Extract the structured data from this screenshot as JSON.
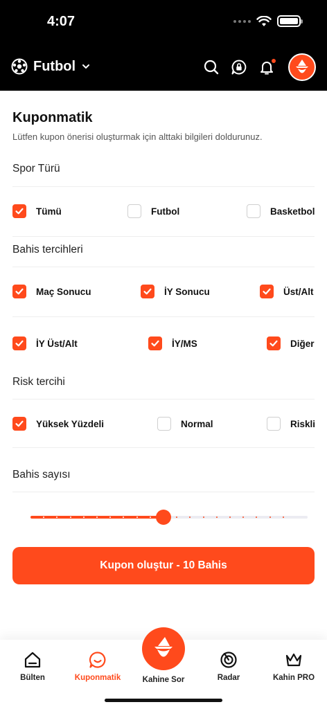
{
  "status": {
    "time": "4:07"
  },
  "header": {
    "sport": "Futbol"
  },
  "page": {
    "title": "Kuponmatik",
    "subtitle": "Lütfen kupon önerisi oluşturmak için alttaki bilgileri doldurunuz."
  },
  "sport_type": {
    "label": "Spor Türü",
    "options": [
      {
        "label": "Tümü",
        "checked": true
      },
      {
        "label": "Futbol",
        "checked": false
      },
      {
        "label": "Basketbol",
        "checked": false
      }
    ]
  },
  "bet_prefs": {
    "label": "Bahis tercihleri",
    "options": [
      {
        "label": "Maç Sonucu",
        "checked": true
      },
      {
        "label": "İY Sonucu",
        "checked": true
      },
      {
        "label": "Üst/Alt",
        "checked": true
      },
      {
        "label": "İY Üst/Alt",
        "checked": true
      },
      {
        "label": "İY/MS",
        "checked": true
      },
      {
        "label": "Diğer",
        "checked": true
      }
    ]
  },
  "risk": {
    "label": "Risk tercihi",
    "options": [
      {
        "label": "Yüksek Yüzdeli",
        "checked": true
      },
      {
        "label": "Normal",
        "checked": false
      },
      {
        "label": "Riskli",
        "checked": false
      }
    ]
  },
  "bet_count": {
    "label": "Bahis sayısı",
    "value": 10,
    "steps": 20
  },
  "cta": {
    "label": "Kupon oluştur - 10 Bahis"
  },
  "tabs": {
    "bulten": "Bülten",
    "kuponmatik": "Kuponmatik",
    "kahine_sor": "Kahine Sor",
    "radar": "Radar",
    "kahin_pro": "Kahin PRO"
  },
  "colors": {
    "accent": "#ff4a1c",
    "header_bg": "#000000"
  }
}
